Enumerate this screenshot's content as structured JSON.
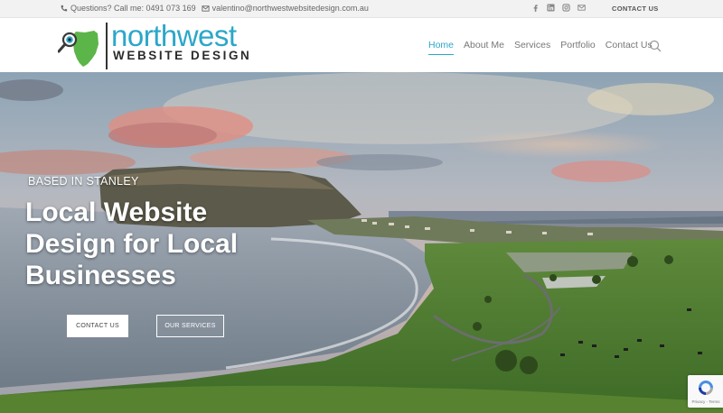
{
  "topbar": {
    "phone_text": "Questions? Call me: 0491 073 169",
    "email_text": "valentino@northwestwebsitedesign.com.au",
    "social_icons": [
      "facebook-icon",
      "linkedin-icon",
      "instagram-icon",
      "mail-icon"
    ],
    "contact_link": "CONTACT US"
  },
  "logo": {
    "name": "northwest",
    "sub": "WEBSITE DESIGN",
    "brand_color": "#2ba7c9"
  },
  "nav": {
    "items": [
      "Home",
      "About Me",
      "Services",
      "Portfolio",
      "Contact Us"
    ],
    "active": "Home",
    "search_icon": "search-icon"
  },
  "hero": {
    "eyebrow": "BASED IN STANLEY",
    "headline": "Local Website Design for Local Businesses",
    "primary_button": "CONTACT US",
    "secondary_button": "OUR SERVICES"
  },
  "recaptcha": {
    "text": "Privacy - Terms"
  }
}
